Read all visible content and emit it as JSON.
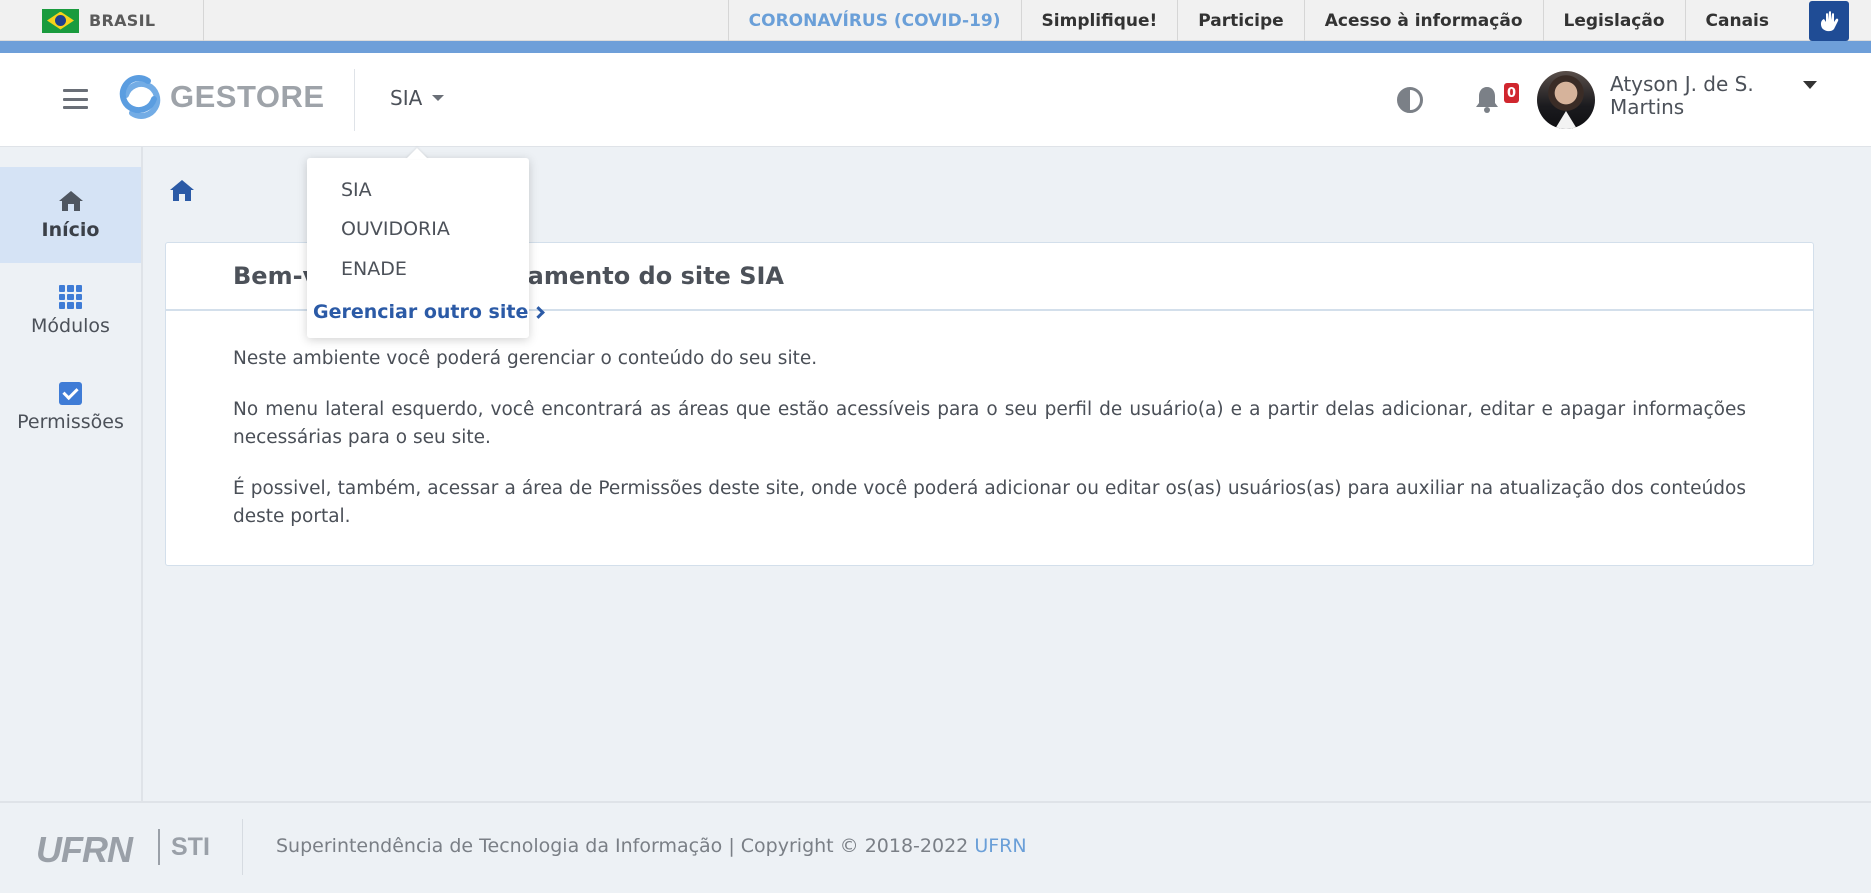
{
  "gov_bar": {
    "country": "BRASIL",
    "links": [
      "CORONAVÍRUS (COVID-19)",
      "Simplifique!",
      "Participe",
      "Acesso à informação",
      "Legislação",
      "Canais"
    ],
    "accessibility_icon": "hand-sign-icon"
  },
  "header": {
    "logo_text": "GESTORE",
    "site_selector": "SIA",
    "notifications_count": "0",
    "user_name": "Atyson J. de S. Martins"
  },
  "dropdown": {
    "items": [
      "SIA",
      "OUVIDORIA",
      "ENADE"
    ],
    "manage_label": "Gerenciar outro site"
  },
  "sidebar": {
    "items": [
      {
        "label": "Início",
        "icon": "home-icon",
        "active": true
      },
      {
        "label": "Módulos",
        "icon": "grid-icon",
        "active": false
      },
      {
        "label": "Permissões",
        "icon": "checkbox-icon",
        "active": false
      }
    ]
  },
  "main": {
    "card_title": "Bem-vindo ao gerenciamento do site SIA",
    "paragraphs": [
      "Neste ambiente você poderá gerenciar o conteúdo do seu site.",
      "No menu lateral esquerdo, você encontrará as áreas que estão acessíveis para o seu perfil de usuário(a) e a partir delas adicionar, editar e apagar informações necessárias para o seu site.",
      "É possivel, também, acessar a área de Permissões deste site, onde você poderá adicionar ou editar os(as) usuários(as) para auxiliar na atualização dos conteúdos deste portal."
    ]
  },
  "footer": {
    "logo_text": "UFRN",
    "unit": "STI",
    "text": "Superintendência de Tecnologia da Informação | Copyright © 2018-2022 ",
    "link": "UFRN"
  },
  "colors": {
    "accent": "#6e9fd9",
    "link": "#2b5aa6",
    "active_bg": "#d5e3f5",
    "badge": "#d0262e"
  }
}
